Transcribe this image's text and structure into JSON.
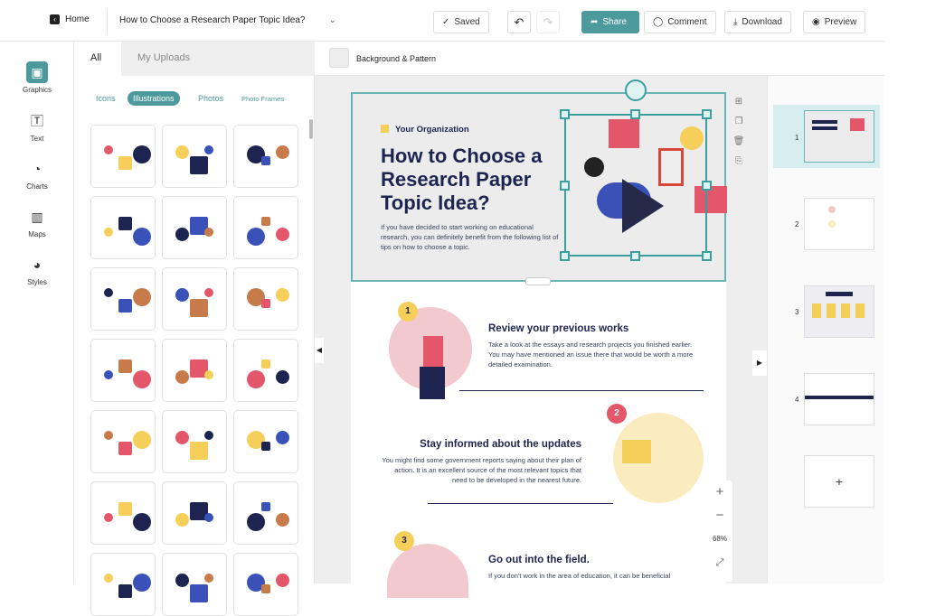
{
  "topbar": {
    "home": "Home",
    "doc_title": "How to Choose a  Research Paper Topic Idea?",
    "saved": "Saved",
    "share": "Share",
    "comment": "Comment",
    "download": "Download",
    "preview": "Preview"
  },
  "rail": [
    {
      "label": "Graphics",
      "icon": "graphics-icon"
    },
    {
      "label": "Text",
      "icon": "text-icon"
    },
    {
      "label": "Charts",
      "icon": "pie-chart-icon"
    },
    {
      "label": "Maps",
      "icon": "map-icon"
    },
    {
      "label": "Styles",
      "icon": "palette-icon"
    }
  ],
  "panel": {
    "tabs": [
      "All",
      "My Uploads"
    ],
    "filters": [
      "Icons",
      "Illustrations",
      "Photos",
      "Photo Frames"
    ],
    "active_filter": "Illustrations"
  },
  "canvas_toolbar": {
    "background": "Background & Pattern"
  },
  "page": {
    "org": "Your Organization",
    "title": "How to Choose a Research Paper Topic Idea?",
    "intro": "If you have decided to start working on educational research, you can definitely benefit from the following list of tips on how to choose a topic.",
    "steps": [
      {
        "num": "1",
        "title": "Review your previous works",
        "text": "Take a look at the essays and research projects you finished earlier. You may have mentioned an issue there that would be worth a more detailed examination."
      },
      {
        "num": "2",
        "title": "Stay informed about the updates",
        "text": "You might find some government reports saying about their plan of action. It is an excellent source of the most relevant topics that need to be developed in the nearest future."
      },
      {
        "num": "3",
        "title": "Go out into the field.",
        "text": "If you don't work in the area of education, it can be beneficial"
      }
    ]
  },
  "zoom": {
    "plus": "+",
    "minus": "−",
    "level": "68%"
  },
  "thumbs": [
    "1",
    "2",
    "3",
    "4"
  ],
  "add_page": "+",
  "colors": {
    "accent": "#4d9a9c",
    "navy": "#1e2450",
    "pink": "#e4566a",
    "yellow": "#f5cf5a"
  }
}
